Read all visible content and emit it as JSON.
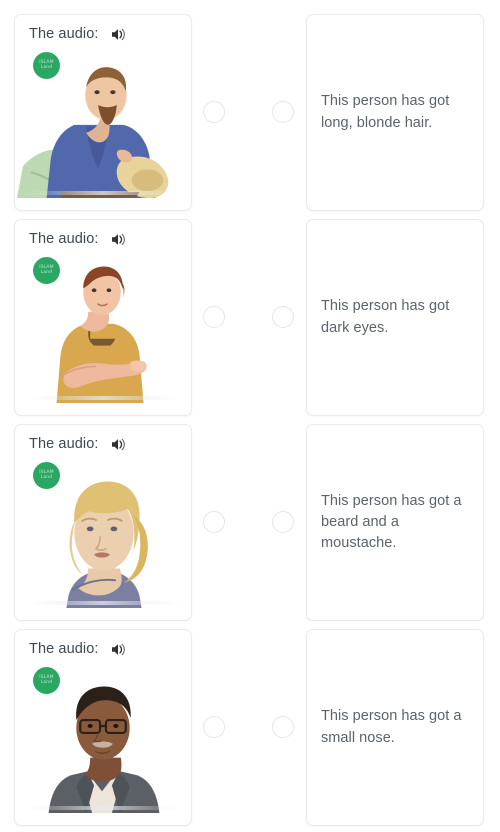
{
  "page": {
    "background_color": "#ffffff",
    "card_border_color": "#e8eaec",
    "radio_border_color": "#e3e6e8",
    "label_text_color": "#3d4852",
    "body_text_color": "#5b636b",
    "watermark_color": "#2aa863"
  },
  "watermark": {
    "line1": "ISLAM",
    "line2": "Land"
  },
  "rows": [
    {
      "audio_label": "The audio:",
      "speaker_icon": "speaker-volume-icon",
      "illustration_name": "man-with-beard-blue-shirt-straw-hat",
      "statement": "This person has got long, blonde hair."
    },
    {
      "audio_label": "The audio:",
      "speaker_icon": "speaker-volume-icon",
      "illustration_name": "woman-auburn-hair-mustard-dress",
      "statement": "This person has got dark eyes."
    },
    {
      "audio_label": "The audio:",
      "speaker_icon": "speaker-volume-icon",
      "illustration_name": "blonde-woman-portrait",
      "statement": "This person has got a beard and a moustache."
    },
    {
      "audio_label": "The audio:",
      "speaker_icon": "speaker-volume-icon",
      "illustration_name": "man-with-glasses-grey-suit",
      "statement": "This person has got a small nose."
    }
  ]
}
